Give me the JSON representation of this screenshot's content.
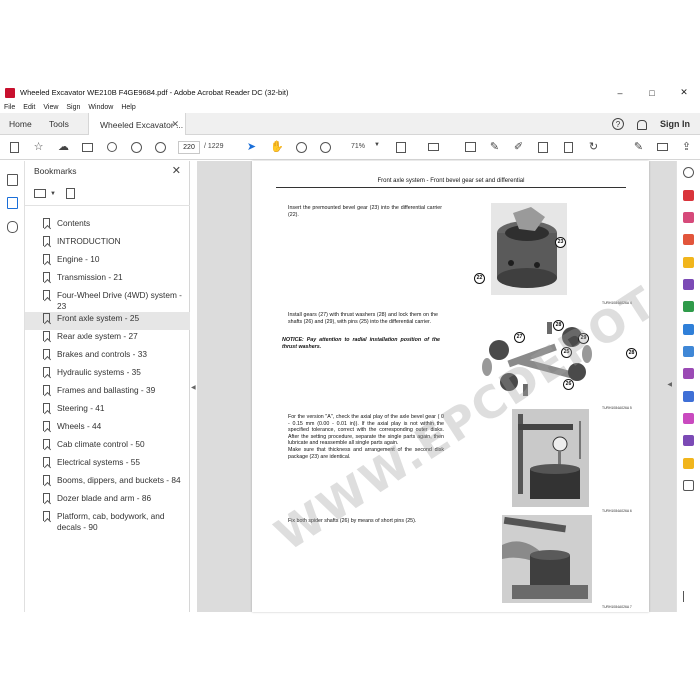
{
  "window": {
    "title": "Wheeled Excavator WE210B F4GE9684.pdf - Adobe Acrobat Reader DC (32-bit)",
    "controls": [
      "–",
      "□",
      "✕"
    ]
  },
  "menu": [
    "File",
    "Edit",
    "View",
    "Sign",
    "Window",
    "Help"
  ],
  "tabs": {
    "home": "Home",
    "tools": "Tools",
    "document": "Wheeled Excavator ...",
    "close": "✕"
  },
  "account": {
    "help": "?",
    "sign_in": "Sign In"
  },
  "toolbar": {
    "page_current": "220",
    "page_total": "/ 1229",
    "zoom": "71%"
  },
  "bookmarks": {
    "title": "Bookmarks",
    "close": "✕",
    "items": [
      "Contents",
      "INTRODUCTION",
      "Engine - 10",
      "Transmission - 21",
      "Four-Wheel Drive (4WD) system - 23",
      "Front axle system - 25",
      "Rear axle system - 27",
      "Brakes and controls - 33",
      "Hydraulic systems - 35",
      "Frames and ballasting - 39",
      "Steering - 41",
      "Wheels - 44",
      "Cab climate control - 50",
      "Electrical systems - 55",
      "Booms, dippers, and buckets - 84",
      "Dozer blade and arm - 86",
      "Platform, cab, bodywork, and decals - 90"
    ],
    "active_index": 5
  },
  "page": {
    "header": "Front axle system - Front bevel gear set and differential",
    "paragraphs": {
      "p1": "Insert the premounted bevel gear (23) into the differential carrier (22).",
      "p2": "Install gears (27) with thrust washers (28) and lock them on the shafts (26) and (29), with pins (25) into the differential carrier.",
      "note": "NOTICE: Pay attention to radial installation position of the thrust washers.",
      "p3": "For the version \"A\", check the axial play of the axle bevel gear ( 0 - 0.15 mm (0.00 - 0.01 in)). If the axial play is not within the specified tolerance, correct with the corresponding outer disks. After the setting procedure, separate the single parts again, then lubricate and reassemble all single parts again.",
      "p3b": "Make sure that thickness and arrangement of the second disk package (23) are identical.",
      "p4": "Fix both spider shafts (26) by means of short pins (25)."
    },
    "figure_captions": [
      "TURH1084A026A 4",
      "TURH1084A026A 5",
      "TURH1084A026A 6",
      "TURH1084A026A 7"
    ],
    "callouts": {
      "fig1": [
        "23",
        "22"
      ],
      "fig2": [
        "27",
        "28",
        "29",
        "25",
        "28",
        "26"
      ]
    },
    "watermark": "WWW.EPCDEPOT.COM"
  }
}
